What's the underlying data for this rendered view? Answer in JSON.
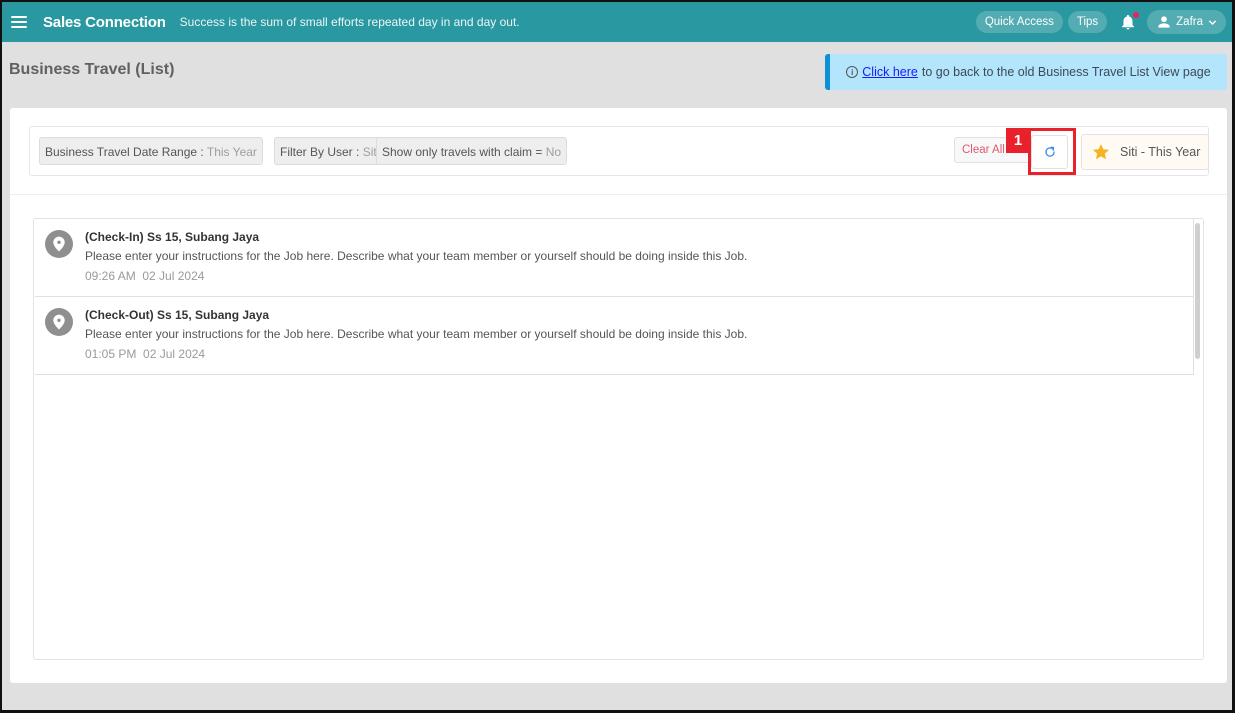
{
  "topbar": {
    "brand": "Sales Connection",
    "tagline": "Success is the sum of small efforts repeated day in and day out.",
    "quick_access": "Quick Access",
    "tips": "Tips",
    "user_name": "Zafra",
    "accent_color": "#2a98a1",
    "notification_dot_color": "#e8245a"
  },
  "page": {
    "title": "Business Travel (List)"
  },
  "banner": {
    "link_text": "Click here",
    "text": "to go back to the old Business Travel List View page"
  },
  "filters": {
    "chips": [
      {
        "label": "Business Travel Date Range",
        "sep": " : ",
        "value": "This Year"
      },
      {
        "label": "Filter By User",
        "sep": " : ",
        "value": "Siti"
      },
      {
        "label": "Show only travels with claim",
        "sep": " = ",
        "value": "No"
      }
    ],
    "clear_all": "Clear All",
    "preset_label": "Siti - This Year"
  },
  "annotation": {
    "step": "1"
  },
  "list": {
    "items": [
      {
        "title": "(Check-In) Ss 15, Subang Jaya",
        "description": "Please enter your instructions for the Job here. Describe what your team member or yourself should be doing inside this Job.",
        "time": "09:26 AM",
        "date": "02 Jul 2024"
      },
      {
        "title": "(Check-Out) Ss 15, Subang Jaya",
        "description": "Please enter your instructions for the Job here. Describe what your team member or yourself should be doing inside this Job.",
        "time": "01:05 PM",
        "date": "02 Jul 2024"
      }
    ]
  }
}
